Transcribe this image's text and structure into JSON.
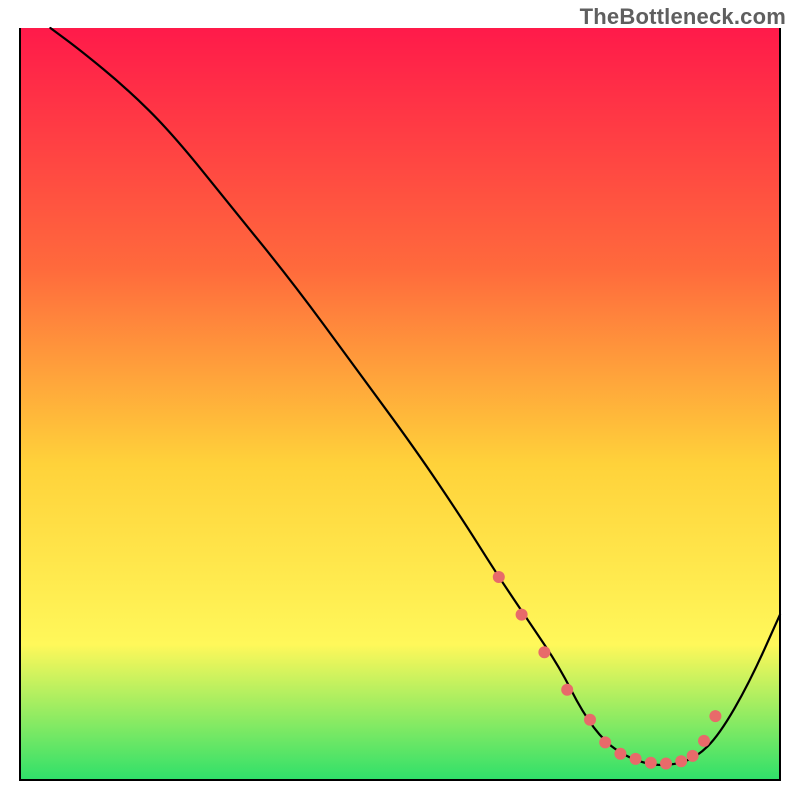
{
  "watermark": "TheBottleneck.com",
  "colors": {
    "grad_top": "#ff1a4a",
    "grad_mid1": "#ff6a3c",
    "grad_mid2": "#ffd23a",
    "grad_mid3": "#fff85a",
    "grad_bottom": "#2fe06a",
    "curve": "#000000",
    "dots": "#e86a6a",
    "border": "#000000"
  },
  "chart_data": {
    "type": "line",
    "title": "",
    "xlabel": "",
    "ylabel": "",
    "xlim": [
      0,
      100
    ],
    "ylim": [
      0,
      100
    ],
    "series": [
      {
        "name": "curve",
        "x": [
          4,
          8,
          14,
          20,
          28,
          36,
          44,
          52,
          58,
          63,
          67,
          71,
          74,
          77,
          80,
          83,
          86,
          89,
          92,
          96,
          100
        ],
        "y": [
          100,
          97,
          92,
          86,
          76,
          66,
          55,
          44,
          35,
          27,
          21,
          15,
          9,
          5,
          3,
          2,
          2,
          3,
          6,
          13,
          22
        ]
      }
    ],
    "annotations": {
      "valley_dots": {
        "x": [
          63,
          66,
          69,
          72,
          75,
          77,
          79,
          81,
          83,
          85,
          87,
          88.5,
          90,
          91.5
        ],
        "y": [
          27,
          22,
          17,
          12,
          8,
          5,
          3.5,
          2.8,
          2.3,
          2.2,
          2.5,
          3.2,
          5.2,
          8.5
        ]
      }
    }
  }
}
